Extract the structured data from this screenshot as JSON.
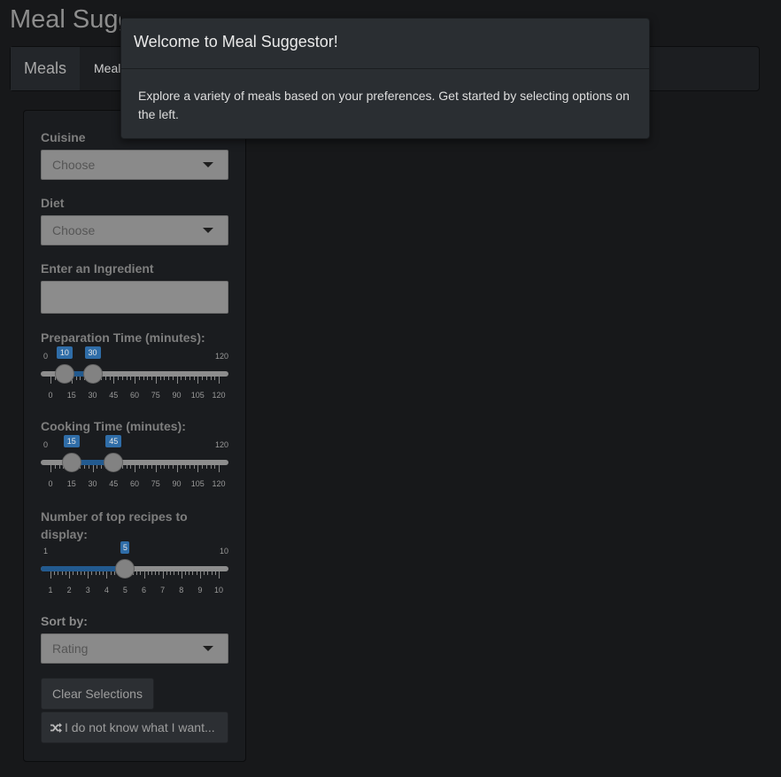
{
  "app": {
    "title": "Meal Suggestor"
  },
  "nav": {
    "tabs": [
      {
        "label": "Meals"
      },
      {
        "label": "Meal"
      }
    ]
  },
  "sidebar": {
    "cuisine": {
      "label": "Cuisine",
      "value": "Choose"
    },
    "diet": {
      "label": "Diet",
      "value": "Choose"
    },
    "ingredient": {
      "label": "Enter an Ingredient",
      "value": ""
    },
    "prep_time": {
      "label": "Preparation Time (minutes):",
      "min": "0",
      "max": "120",
      "from": "10",
      "to": "30",
      "from_value": 10,
      "to_value": 30,
      "range_min": 0,
      "range_max": 120,
      "ticks": [
        "0",
        "15",
        "30",
        "45",
        "60",
        "75",
        "90",
        "105",
        "120"
      ]
    },
    "cook_time": {
      "label": "Cooking Time (minutes):",
      "min": "0",
      "max": "120",
      "from": "15",
      "to": "45",
      "from_value": 15,
      "to_value": 45,
      "range_min": 0,
      "range_max": 120,
      "ticks": [
        "0",
        "15",
        "30",
        "45",
        "60",
        "75",
        "90",
        "105",
        "120"
      ]
    },
    "top_recipes": {
      "label": "Number of top recipes to display:",
      "min": "1",
      "max": "10",
      "value_label": "5",
      "value": 5,
      "range_min": 1,
      "range_max": 10,
      "ticks": [
        "1",
        "2",
        "3",
        "4",
        "5",
        "6",
        "7",
        "8",
        "9",
        "10"
      ]
    },
    "sort_by": {
      "label": "Sort by:",
      "value": "Rating"
    },
    "clear_button": "Clear Selections",
    "random_button": "I do not know what I want..."
  },
  "modal": {
    "title": "Welcome to Meal Suggestor!",
    "body": "Explore a variety of meals based on your preferences. Get started by selecting options on the left."
  },
  "colors": {
    "background": "#17181a",
    "accent": "#2f6da8",
    "modal_bg": "#2a2e32"
  }
}
